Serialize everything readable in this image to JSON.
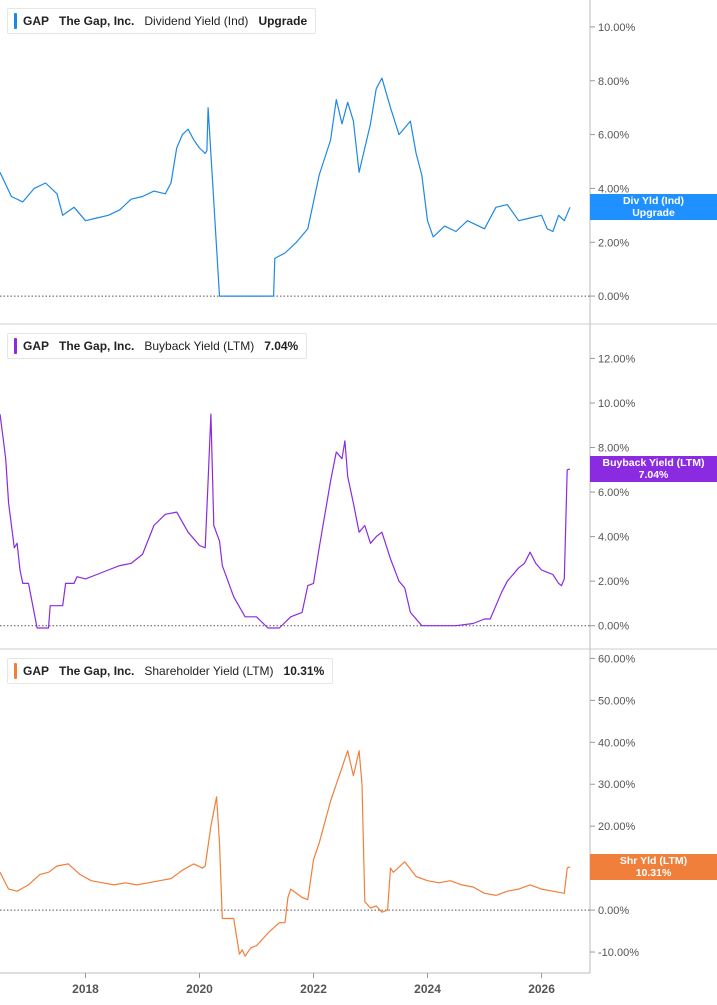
{
  "colors": {
    "panel1": "#1e88e5",
    "panel2": "#8a2be2",
    "panel3": "#f07f3c",
    "tag1": "#1e90ff",
    "tag2": "#8a2be2",
    "tag3": "#f07f3c",
    "axis_text": "#555555",
    "grid": "#cccccc"
  },
  "panels": [
    {
      "legend": {
        "ticker": "GAP",
        "company": "The Gap, Inc.",
        "metric": "Dividend Yield (Ind)",
        "value": "Upgrade"
      },
      "tag": {
        "line1": "Div Yld (Ind)",
        "line2": "Upgrade"
      }
    },
    {
      "legend": {
        "ticker": "GAP",
        "company": "The Gap, Inc.",
        "metric": "Buyback Yield (LTM)",
        "value": "7.04%"
      },
      "tag": {
        "line1": "Buyback Yield (LTM)",
        "line2": "7.04%"
      }
    },
    {
      "legend": {
        "ticker": "GAP",
        "company": "The Gap, Inc.",
        "metric": "Shareholder Yield (LTM)",
        "value": "10.31%"
      },
      "tag": {
        "line1": "Shr Yld (LTM)",
        "line2": "10.31%"
      }
    }
  ],
  "x_axis": {
    "ticks": [
      "2018",
      "2020",
      "2022",
      "2024",
      "2026"
    ],
    "tick_years": [
      2018,
      2020,
      2022,
      2024,
      2026
    ],
    "range": [
      2016.5,
      2026.85
    ]
  },
  "chart_data": [
    {
      "type": "line",
      "title": "",
      "series": [
        {
          "name": "Dividend Yield (Ind)",
          "x": [
            2016.5,
            2016.7,
            2016.9,
            2017.1,
            2017.3,
            2017.5,
            2017.6,
            2017.8,
            2018.0,
            2018.2,
            2018.4,
            2018.6,
            2018.8,
            2019.0,
            2019.2,
            2019.4,
            2019.5,
            2019.6,
            2019.7,
            2019.8,
            2019.9,
            2020.0,
            2020.1,
            2020.13,
            2020.15,
            2020.35,
            2020.6,
            2020.9,
            2021.2,
            2021.3,
            2021.32,
            2021.5,
            2021.7,
            2021.9,
            2022.0,
            2022.1,
            2022.3,
            2022.4,
            2022.5,
            2022.6,
            2022.7,
            2022.8,
            2022.9,
            2023.0,
            2023.1,
            2023.2,
            2023.35,
            2023.5,
            2023.7,
            2023.8,
            2023.9,
            2024.0,
            2024.1,
            2024.3,
            2024.5,
            2024.7,
            2024.9,
            2025.0,
            2025.2,
            2025.4,
            2025.6,
            2025.8,
            2026.0,
            2026.1,
            2026.2,
            2026.3,
            2026.4,
            2026.5
          ],
          "y": [
            4.6,
            3.7,
            3.5,
            4.0,
            4.2,
            3.8,
            3.0,
            3.3,
            2.8,
            2.9,
            3.0,
            3.2,
            3.6,
            3.7,
            3.9,
            3.8,
            4.2,
            5.5,
            6.0,
            6.2,
            5.8,
            5.5,
            5.3,
            5.4,
            7.0,
            0.0,
            0.0,
            0.0,
            0.0,
            0.0,
            1.4,
            1.6,
            2.0,
            2.5,
            3.5,
            4.5,
            5.8,
            7.3,
            6.4,
            7.2,
            6.5,
            4.6,
            5.5,
            6.4,
            7.7,
            8.1,
            7.0,
            6.0,
            6.5,
            5.3,
            4.5,
            2.8,
            2.2,
            2.6,
            2.4,
            2.8,
            2.6,
            2.5,
            3.3,
            3.4,
            2.8,
            2.9,
            3.0,
            2.5,
            2.4,
            3.0,
            2.8,
            3.3
          ]
        }
      ],
      "ylabel": "",
      "ylim": [
        -1.0,
        11.0
      ],
      "y_ticks": [
        0,
        2,
        4,
        6,
        8,
        10
      ],
      "y_tick_labels": [
        "0.00%",
        "2.00%",
        "4.00%",
        "6.00%",
        "8.00%",
        "10.00%"
      ]
    },
    {
      "type": "line",
      "title": "",
      "series": [
        {
          "name": "Buyback Yield (LTM)",
          "x": [
            2016.5,
            2016.55,
            2016.6,
            2016.65,
            2016.75,
            2016.8,
            2016.85,
            2016.9,
            2017.0,
            2017.15,
            2017.35,
            2017.38,
            2017.6,
            2017.65,
            2017.8,
            2017.85,
            2018.0,
            2018.2,
            2018.4,
            2018.6,
            2018.8,
            2019.0,
            2019.2,
            2019.4,
            2019.6,
            2019.8,
            2019.9,
            2020.0,
            2020.1,
            2020.15,
            2020.2,
            2020.25,
            2020.35,
            2020.4,
            2020.6,
            2020.8,
            2021.0,
            2021.2,
            2021.4,
            2021.6,
            2021.8,
            2021.9,
            2022.0,
            2022.1,
            2022.2,
            2022.3,
            2022.4,
            2022.5,
            2022.55,
            2022.6,
            2022.7,
            2022.8,
            2022.9,
            2023.0,
            2023.1,
            2023.2,
            2023.35,
            2023.5,
            2023.6,
            2023.7,
            2023.9,
            2024.2,
            2024.5,
            2024.8,
            2025.0,
            2025.1,
            2025.2,
            2025.3,
            2025.4,
            2025.5,
            2025.6,
            2025.7,
            2025.8,
            2025.9,
            2026.0,
            2026.1,
            2026.2,
            2026.3,
            2026.35,
            2026.4,
            2026.45,
            2026.5
          ],
          "y": [
            9.5,
            8.5,
            7.5,
            5.5,
            3.5,
            3.7,
            2.5,
            1.9,
            1.9,
            -0.1,
            -0.1,
            0.9,
            0.9,
            1.9,
            1.9,
            2.2,
            2.1,
            2.3,
            2.5,
            2.7,
            2.8,
            3.2,
            4.5,
            5.0,
            5.1,
            4.2,
            3.9,
            3.6,
            3.5,
            6.5,
            9.5,
            4.5,
            3.8,
            2.7,
            1.3,
            0.4,
            0.4,
            -0.1,
            -0.1,
            0.4,
            0.6,
            1.8,
            1.9,
            3.5,
            5.0,
            6.5,
            7.8,
            7.5,
            8.3,
            6.7,
            5.5,
            4.2,
            4.5,
            3.7,
            4.0,
            4.2,
            3.0,
            2.0,
            1.7,
            0.6,
            0.0,
            0.0,
            0.0,
            0.1,
            0.3,
            0.3,
            0.9,
            1.5,
            2.0,
            2.3,
            2.6,
            2.8,
            3.3,
            2.8,
            2.5,
            2.4,
            2.3,
            1.9,
            1.8,
            2.1,
            7.0,
            7.04
          ]
        }
      ],
      "ylabel": "",
      "ylim": [
        -1.0,
        13.5
      ],
      "y_ticks": [
        0,
        2,
        4,
        6,
        8,
        10,
        12
      ],
      "y_tick_labels": [
        "0.00%",
        "2.00%",
        "4.00%",
        "6.00%",
        "8.00%",
        "10.00%",
        "12.00%"
      ]
    },
    {
      "type": "line",
      "title": "",
      "series": [
        {
          "name": "Shareholder Yield (LTM)",
          "x": [
            2016.5,
            2016.65,
            2016.8,
            2017.0,
            2017.2,
            2017.35,
            2017.5,
            2017.7,
            2017.9,
            2018.1,
            2018.3,
            2018.5,
            2018.7,
            2018.9,
            2019.1,
            2019.3,
            2019.5,
            2019.7,
            2019.9,
            2020.05,
            2020.1,
            2020.2,
            2020.3,
            2020.35,
            2020.4,
            2020.6,
            2020.7,
            2020.75,
            2020.8,
            2020.9,
            2021.0,
            2021.2,
            2021.4,
            2021.5,
            2021.55,
            2021.6,
            2021.8,
            2021.9,
            2022.0,
            2022.1,
            2022.2,
            2022.3,
            2022.4,
            2022.5,
            2022.6,
            2022.7,
            2022.8,
            2022.85,
            2022.9,
            2023.0,
            2023.1,
            2023.2,
            2023.3,
            2023.35,
            2023.4,
            2023.6,
            2023.8,
            2024.0,
            2024.2,
            2024.4,
            2024.6,
            2024.8,
            2025.0,
            2025.2,
            2025.4,
            2025.6,
            2025.8,
            2026.0,
            2026.2,
            2026.4,
            2026.45,
            2026.5
          ],
          "y": [
            9.0,
            5.0,
            4.5,
            6.0,
            8.5,
            9.0,
            10.5,
            11.0,
            8.5,
            7.0,
            6.5,
            6.0,
            6.5,
            6.0,
            6.5,
            7.0,
            7.5,
            9.5,
            11.0,
            10.0,
            10.5,
            20.0,
            27.0,
            16.0,
            -2.0,
            -2.0,
            -10.5,
            -9.5,
            -11.0,
            -9.0,
            -8.5,
            -5.5,
            -3.0,
            -3.0,
            3.0,
            5.0,
            3.0,
            2.5,
            12.0,
            16.0,
            21.0,
            26.0,
            30.0,
            34.0,
            38.0,
            32.0,
            38.0,
            30.0,
            2.0,
            0.5,
            1.0,
            -0.5,
            0.0,
            10.0,
            9.0,
            11.5,
            8.0,
            7.0,
            6.5,
            7.0,
            6.0,
            5.5,
            4.0,
            3.5,
            4.5,
            5.0,
            6.0,
            5.0,
            4.5,
            4.0,
            10.0,
            10.31
          ]
        }
      ],
      "ylabel": "",
      "ylim": [
        -15.0,
        62.0
      ],
      "y_ticks": [
        -10,
        0,
        10,
        20,
        30,
        40,
        50,
        60
      ],
      "y_tick_labels": [
        "-10.00%",
        "0.00%",
        "10.00%",
        "20.00%",
        "30.00%",
        "40.00%",
        "50.00%",
        "60.00%"
      ]
    }
  ]
}
